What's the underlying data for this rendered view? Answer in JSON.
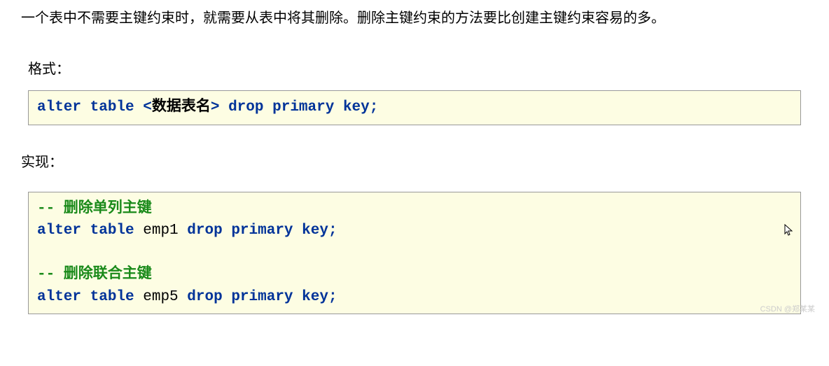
{
  "intro": "一个表中不需要主键约束时，就需要从表中将其删除。删除主键约束的方法要比创建主键约束容易的多。",
  "labels": {
    "format": "格式：",
    "implement": "实现："
  },
  "format_code": {
    "tokens": {
      "alter": "alter",
      "table": "table",
      "open_angle": "<",
      "table_name_placeholder": "数据表名",
      "close_angle": ">",
      "drop": "drop",
      "primary": "primary",
      "key": "key",
      "semicolon": ";"
    }
  },
  "impl_code": {
    "comment1": "-- 删除单列主键",
    "line1": {
      "alter": "alter",
      "table": "table",
      "ident": "emp1",
      "drop": "drop",
      "primary": "primary",
      "key": "key",
      "semicolon": ";"
    },
    "comment2": "-- 删除联合主键",
    "line2": {
      "alter": "alter",
      "table": "table",
      "ident": "emp5",
      "drop": "drop",
      "primary": "primary",
      "key": "key",
      "semicolon": ";"
    }
  },
  "watermark": "CSDN @郑某某"
}
